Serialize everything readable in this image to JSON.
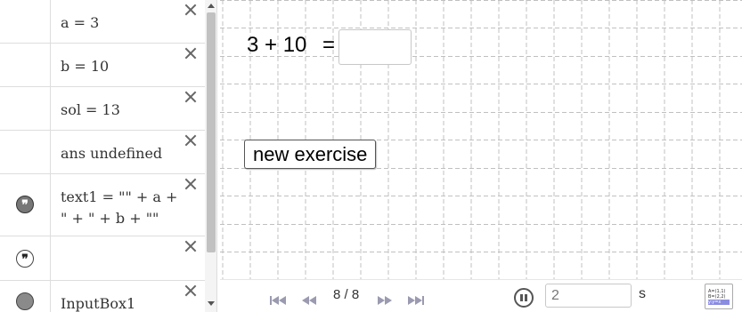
{
  "algebra": {
    "rows": [
      {
        "label": "a = 3",
        "marble": "none"
      },
      {
        "label": "b = 10",
        "marble": "none"
      },
      {
        "label": "sol = 13",
        "marble": "none"
      },
      {
        "label": "ans undefined",
        "marble": "none"
      },
      {
        "label_line1": "text1 = \"\" + a +",
        "label_line2": "\" + \" + b + \"\"",
        "marble": "quote-dark-icon"
      },
      {
        "label": "",
        "marble": "quote-light-icon"
      },
      {
        "label": "InputBox1",
        "marble": "circle-gray-icon"
      }
    ],
    "quote_glyph": "❞"
  },
  "graphics": {
    "equation_text": "3 + 10",
    "equals_sign": "=",
    "answer_value": "",
    "new_exercise_label": "new exercise"
  },
  "playback": {
    "step_counter": "8 / 8",
    "speed_value": "2",
    "speed_unit": "s",
    "table_icon_lines": [
      "A=(1,1)",
      "B=(2,2)",
      "y:y=x"
    ]
  }
}
